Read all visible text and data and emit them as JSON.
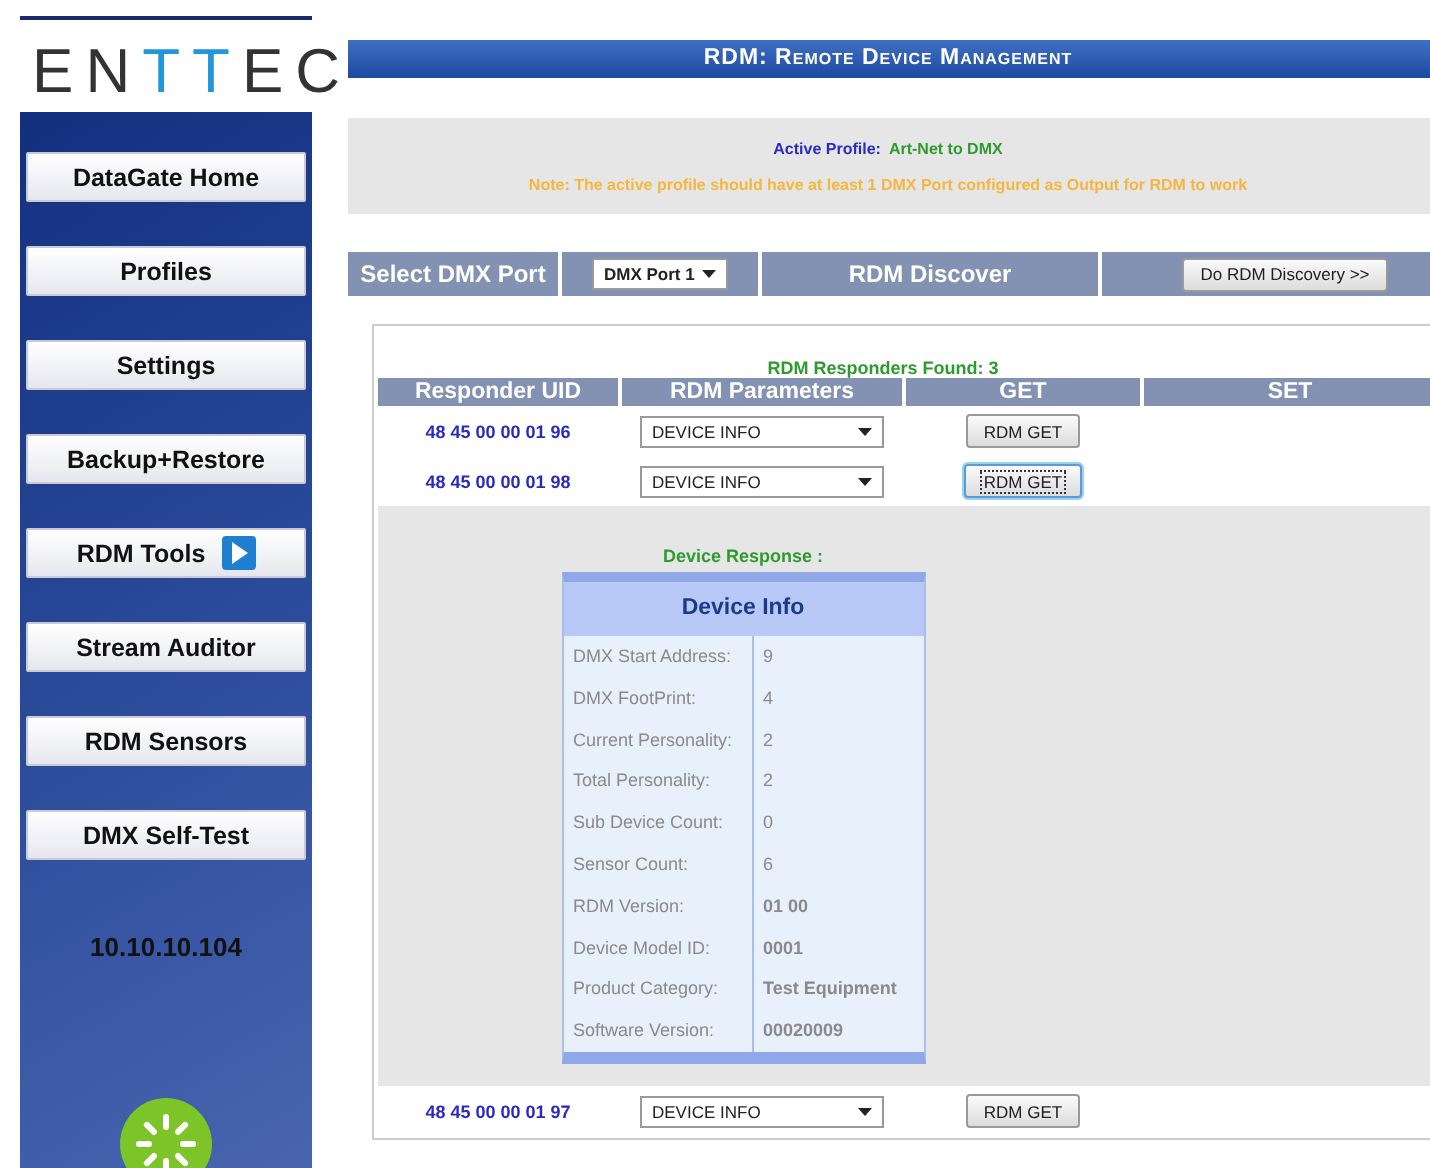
{
  "logo": {
    "letters": [
      {
        "char": "E",
        "accent": false
      },
      {
        "char": "N",
        "accent": false
      },
      {
        "char": "T",
        "accent": true
      },
      {
        "char": "T",
        "accent": true
      },
      {
        "char": "E",
        "accent": false
      },
      {
        "char": "C",
        "accent": false
      }
    ]
  },
  "sidebar": {
    "items": [
      {
        "label": "DataGate Home",
        "selected": false
      },
      {
        "label": "Profiles",
        "selected": false
      },
      {
        "label": "Settings",
        "selected": false
      },
      {
        "label": "Backup+Restore",
        "selected": false
      },
      {
        "label": "RDM Tools",
        "selected": true
      },
      {
        "label": "Stream Auditor",
        "selected": false
      },
      {
        "label": "RDM Sensors",
        "selected": false
      },
      {
        "label": "DMX Self-Test",
        "selected": false
      }
    ],
    "ip_address": "10.10.10.104"
  },
  "page_title": "RDM: Remote Device Management",
  "notice": {
    "profile_label": "Active Profile:",
    "profile_value": "Art-Net to DMX",
    "note": "Note: The active profile should have at least 1 DMX Port configured as Output for RDM to work"
  },
  "port_bar": {
    "select_label": "Select DMX Port",
    "port_value": "DMX Port 1",
    "discover_label": "RDM Discover",
    "discover_button": "Do RDM Discovery >>"
  },
  "responders": {
    "found": "RDM Responders Found: 3",
    "columns": [
      "Responder UID",
      "RDM Parameters",
      "GET",
      "SET"
    ],
    "rows": [
      {
        "uid": "48 45 00 00 01 96",
        "parameter": "DEVICE INFO",
        "get_button": "RDM GET",
        "focused": false
      },
      {
        "uid": "48 45 00 00 01 98",
        "parameter": "DEVICE INFO",
        "get_button": "RDM GET",
        "focused": true,
        "response": {
          "heading": "Device Response :",
          "title": "Device Info",
          "fields": [
            {
              "label": "DMX Start Address:",
              "value": "9",
              "bold": false
            },
            {
              "label": "DMX FootPrint:",
              "value": "4",
              "bold": false
            },
            {
              "label": "Current Personality:",
              "value": "2",
              "bold": false
            },
            {
              "label": "Total Personality:",
              "value": "2",
              "bold": false
            },
            {
              "label": "Sub Device Count:",
              "value": "0",
              "bold": false
            },
            {
              "label": "Sensor Count:",
              "value": "6",
              "bold": false
            },
            {
              "label": "RDM Version:",
              "value": "01 00",
              "bold": true
            },
            {
              "label": "Device Model ID:",
              "value": "0001",
              "bold": true
            },
            {
              "label": "Product Category:",
              "value": "Test Equipment",
              "bold": true
            },
            {
              "label": "Software Version:",
              "value": "00020009",
              "bold": true
            }
          ]
        }
      },
      {
        "uid": "48 45 00 00 01 97",
        "parameter": "DEVICE INFO",
        "get_button": "RDM GET",
        "focused": false
      }
    ]
  }
}
